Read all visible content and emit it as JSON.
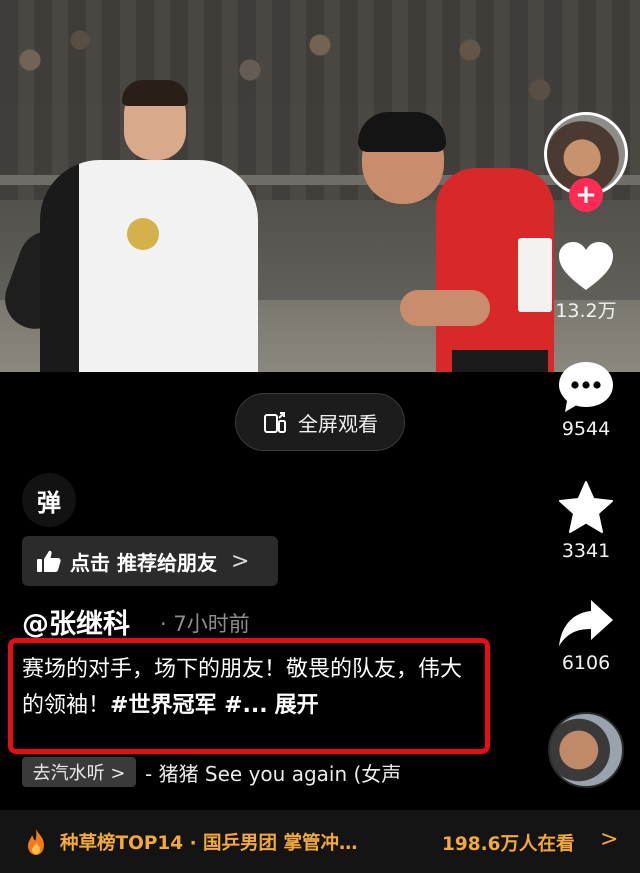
{
  "video": {
    "fullscreen_label": "全屏观看"
  },
  "danmaku": {
    "label": "弹"
  },
  "recommend": {
    "label": "点击 推荐给朋友",
    "chevron": ">"
  },
  "post": {
    "author": "@张继科",
    "time": "· 7小时前",
    "caption_text": "赛场的对手，场下的朋友！敬畏的队友，伟大的领袖！",
    "caption_tags": "#世界冠军 #...",
    "expand_label": "展开"
  },
  "music": {
    "tag": "去汽水听 >",
    "title": "- 猪猪    See you again (女声"
  },
  "rail": {
    "likes": "13.2万",
    "comments": "9544",
    "favorites": "3341",
    "shares": "6106",
    "follow_symbol": "+"
  },
  "banner": {
    "text": "种草榜TOP14 · 国乒男团 掌管冲…",
    "viewers": "198.6万人在看",
    "chevron": ">"
  },
  "icons": [
    "fullscreen-icon",
    "thumbs-up-icon",
    "heart-icon",
    "comment-icon",
    "star-icon",
    "share-icon",
    "fire-icon"
  ],
  "colors": {
    "background": "#000000",
    "highlight_border": "#e60e14",
    "follow_button": "#fe2c55",
    "banner_text": "#f3a93b"
  }
}
